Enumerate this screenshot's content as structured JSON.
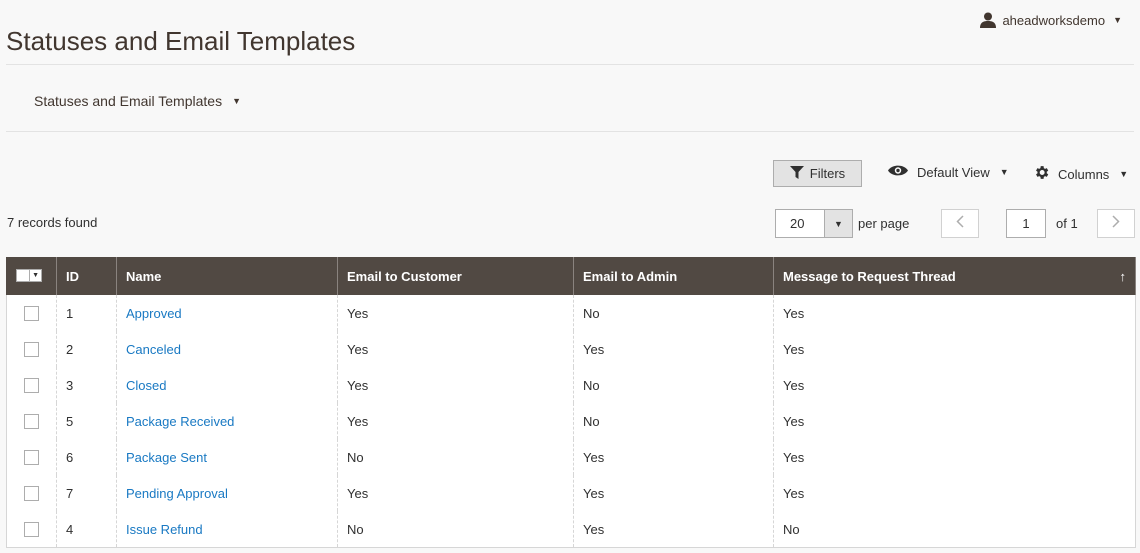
{
  "header": {
    "title": "Statuses and Email Templates",
    "user": "aheadworksdemo"
  },
  "store_switcher": {
    "label": "Statuses and Email Templates"
  },
  "toolbar": {
    "filters_label": "Filters",
    "view_label": "Default View",
    "columns_label": "Columns"
  },
  "grid_info": {
    "records_found": "7 records found",
    "per_page_value": "20",
    "per_page_label": "per page",
    "current_page": "1",
    "page_total": "of 1"
  },
  "grid": {
    "columns": [
      "ID",
      "Name",
      "Email to Customer",
      "Email to Admin",
      "Message to Request Thread"
    ],
    "sort_indicator": "↑",
    "rows": [
      {
        "id": "1",
        "name": "Approved",
        "email_customer": "Yes",
        "email_admin": "No",
        "message_thread": "Yes"
      },
      {
        "id": "2",
        "name": "Canceled",
        "email_customer": "Yes",
        "email_admin": "Yes",
        "message_thread": "Yes"
      },
      {
        "id": "3",
        "name": "Closed",
        "email_customer": "Yes",
        "email_admin": "No",
        "message_thread": "Yes"
      },
      {
        "id": "5",
        "name": "Package Received",
        "email_customer": "Yes",
        "email_admin": "No",
        "message_thread": "Yes"
      },
      {
        "id": "6",
        "name": "Package Sent",
        "email_customer": "No",
        "email_admin": "Yes",
        "message_thread": "Yes"
      },
      {
        "id": "7",
        "name": "Pending Approval",
        "email_customer": "Yes",
        "email_admin": "Yes",
        "message_thread": "Yes"
      },
      {
        "id": "4",
        "name": "Issue Refund",
        "email_customer": "No",
        "email_admin": "Yes",
        "message_thread": "No"
      }
    ]
  },
  "icons": {
    "user": "user-icon",
    "filter": "filter-icon",
    "eye": "eye-icon",
    "gear": "gear-icon",
    "prev": "chevron-left-icon",
    "next": "chevron-right-icon"
  },
  "colors": {
    "header_bg": "#514943",
    "link": "#1979c3",
    "page_bg": "#f8f8f8"
  }
}
